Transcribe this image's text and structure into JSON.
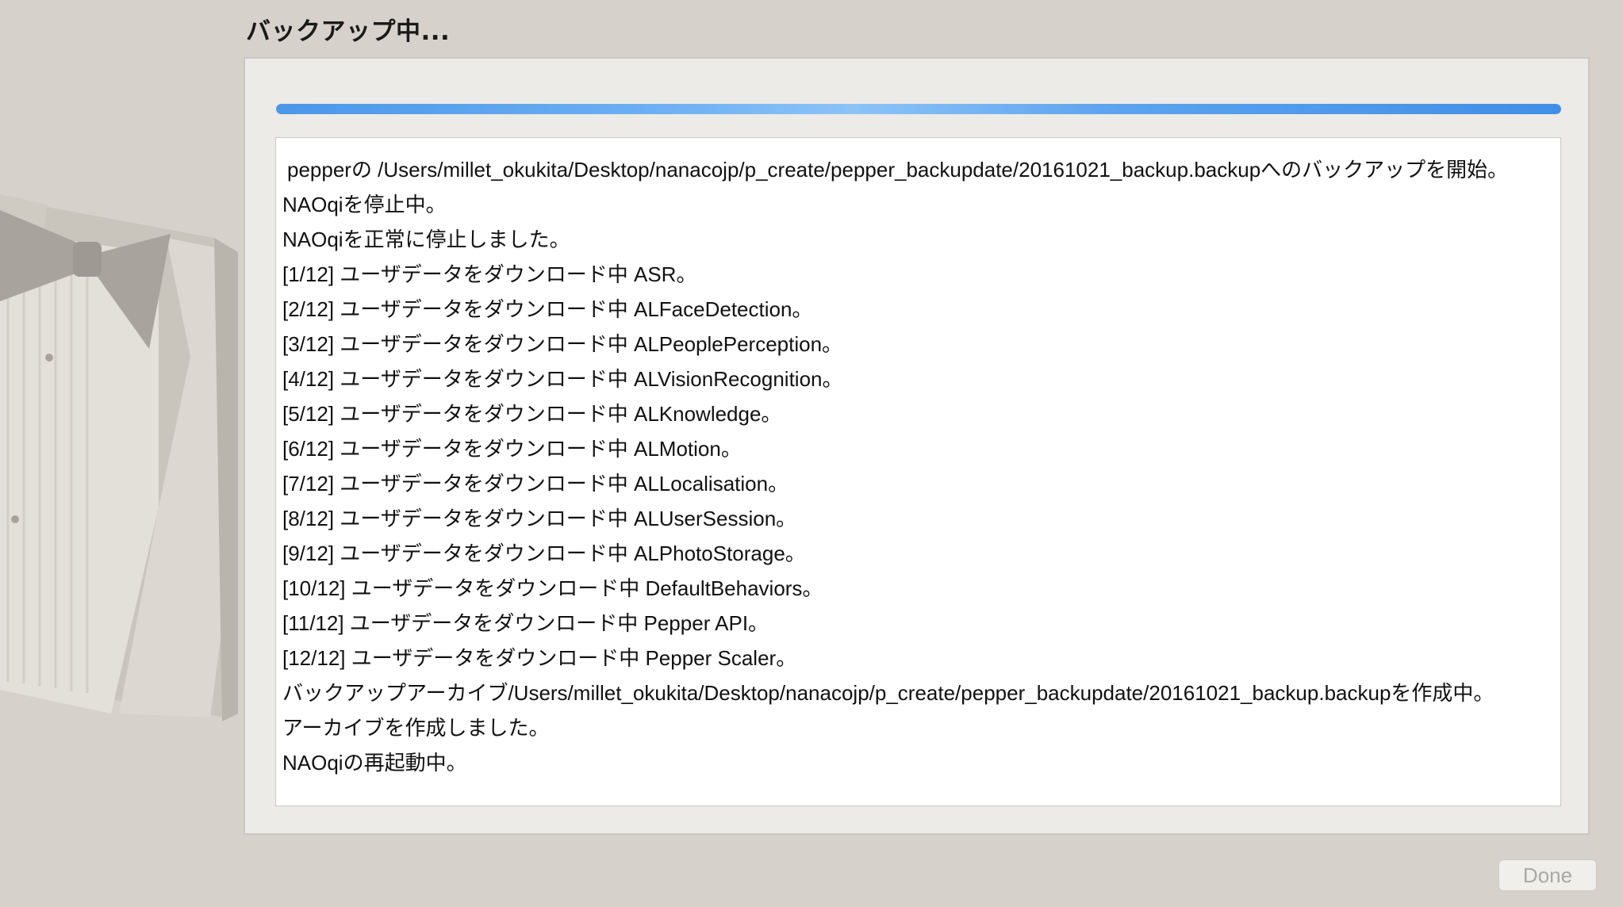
{
  "window": {
    "title": "バックアップ中..."
  },
  "progress": {
    "value_percent": 100,
    "color": "#4a97e8"
  },
  "log": {
    "lines": [
      "pepperの /Users/millet_okukita/Desktop/nanacojp/p_create/pepper_backupdate/20161021_backup.backupへのバックアップを開始。",
      "NAOqiを停止中。",
      "NAOqiを正常に停止しました。",
      "[1/12] ユーザデータをダウンロード中 ASR。",
      "[2/12] ユーザデータをダウンロード中 ALFaceDetection。",
      "[3/12] ユーザデータをダウンロード中 ALPeoplePerception。",
      "[4/12] ユーザデータをダウンロード中 ALVisionRecognition。",
      "[5/12] ユーザデータをダウンロード中 ALKnowledge。",
      "[6/12] ユーザデータをダウンロード中 ALMotion。",
      "[7/12] ユーザデータをダウンロード中 ALLocalisation。",
      "[8/12] ユーザデータをダウンロード中 ALUserSession。",
      "[9/12] ユーザデータをダウンロード中 ALPhotoStorage。",
      "[10/12] ユーザデータをダウンロード中 DefaultBehaviors。",
      "[11/12] ユーザデータをダウンロード中 Pepper API。",
      "[12/12] ユーザデータをダウンロード中 Pepper Scaler。",
      "バックアップアーカイブ/Users/millet_okukita/Desktop/nanacojp/p_create/pepper_backupdate/20161021_backup.backupを作成中。",
      "アーカイブを作成しました。",
      "NAOqiの再起動中。"
    ]
  },
  "footer": {
    "done_label": "Done"
  },
  "colors": {
    "background": "#d6d2cb",
    "panel": "#ecebe7",
    "text": "#111111",
    "disabled_text": "#a9a8a5"
  },
  "icons": {
    "background_art": "tuxedo-bowtie-illustration"
  }
}
